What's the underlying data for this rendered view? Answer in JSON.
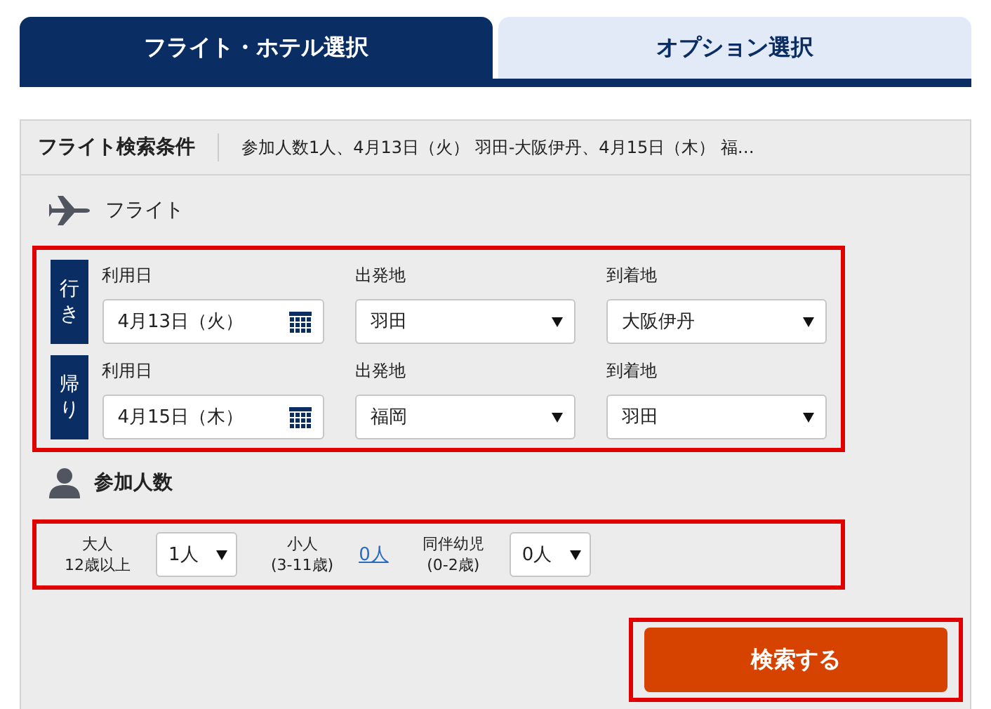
{
  "tabs": [
    {
      "label": "フライト・ホテル選択",
      "selected": true
    },
    {
      "label": "オプション選択",
      "selected": false
    }
  ],
  "summary": {
    "title": "フライト検索条件",
    "text": "参加人数1人、4月13日（火） 羽田-大阪伊丹、4月15日（木） 福…"
  },
  "flight": {
    "title": "フライト",
    "trips": [
      {
        "badge": "行き",
        "date_label": "利用日",
        "date": "4月13日（火）",
        "from_label": "出発地",
        "from": "羽田",
        "to_label": "到着地",
        "to": "大阪伊丹"
      },
      {
        "badge": "帰り",
        "date_label": "利用日",
        "date": "4月15日（木）",
        "from_label": "出発地",
        "from": "福岡",
        "to_label": "到着地",
        "to": "羽田"
      }
    ]
  },
  "passengers": {
    "title": "参加人数",
    "groups": [
      {
        "kind": "select",
        "label": "大人",
        "sublabel": "12歳以上",
        "value": "1人"
      },
      {
        "kind": "link",
        "label": "小人",
        "sublabel": "(3-11歳)",
        "value": "0人"
      },
      {
        "kind": "select",
        "label": "同伴幼児",
        "sublabel": "(0-2歳)",
        "value": "0人"
      }
    ]
  },
  "search_button": "検索する"
}
